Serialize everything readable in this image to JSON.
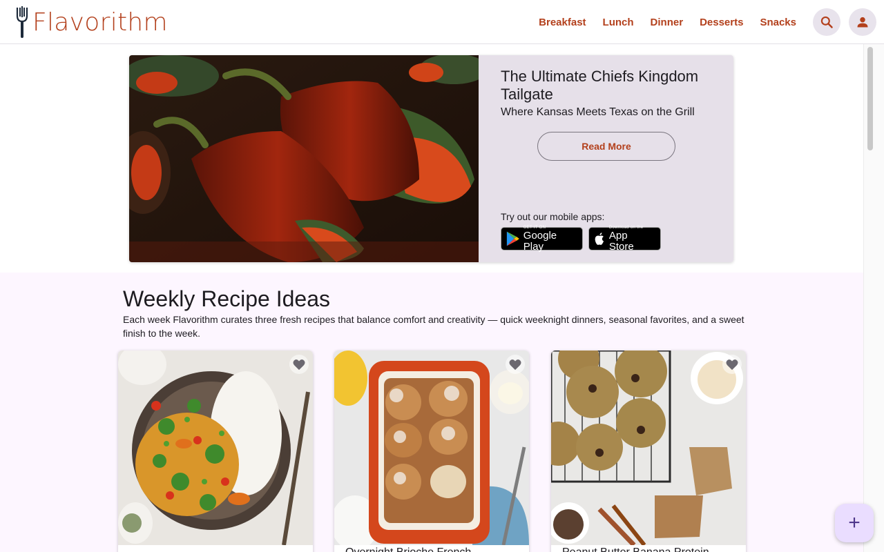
{
  "brand": {
    "name": "Flavorithm",
    "color": "#b3401c"
  },
  "nav": {
    "links": [
      "Breakfast",
      "Lunch",
      "Dinner",
      "Desserts",
      "Snacks"
    ],
    "search_icon": "search-icon",
    "account_icon": "account-icon"
  },
  "hero": {
    "title": "The Ultimate Chiefs Kingdom Tailgate",
    "subtitle": "Where Kansas Meets Texas on the Grill",
    "cta": "Read More",
    "apps_label": "Try out our mobile apps:",
    "google_play": {
      "small": "GET IT ON",
      "big": "Google Play"
    },
    "app_store": {
      "small": "Download on the",
      "big": "App Store"
    }
  },
  "weekly": {
    "title": "Weekly Recipe Ideas",
    "description": "Each week Flavorithm curates three fresh recipes that balance comfort and creativity — quick weeknight dinners, seasonal favorites, and a sweet finish to the week.",
    "cards": [
      {
        "title": "",
        "favorite_icon": "heart-icon"
      },
      {
        "title": "Overnight Brioche French",
        "favorite_icon": "heart-icon"
      },
      {
        "title": "Peanut Butter Banana Protein",
        "favorite_icon": "heart-icon"
      }
    ]
  },
  "fab": {
    "label": "+"
  }
}
